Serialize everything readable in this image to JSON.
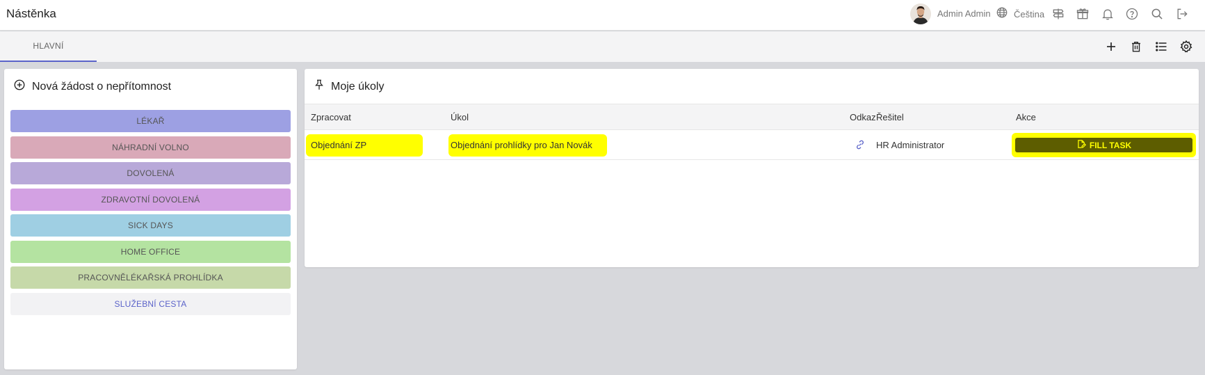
{
  "header": {
    "title": "Nástěnka",
    "user_name": "Admin Admin",
    "language": "Čeština",
    "icons": [
      "globe-icon",
      "signpost-icon",
      "gift-icon",
      "bell-icon",
      "help-icon",
      "search-icon",
      "logout-icon"
    ]
  },
  "tabs": [
    {
      "label": "HLAVNÍ",
      "active": true
    }
  ],
  "tab_tools": [
    "add-icon",
    "trash-icon",
    "list-icon",
    "settings-icon"
  ],
  "absence_card": {
    "title": "Nová žádost o nepřítomnost",
    "buttons": [
      {
        "label": "LÉKAŘ",
        "color": "#9da0e3"
      },
      {
        "label": "NÁHRADNÍ VOLNO",
        "color": "#d9a9b8"
      },
      {
        "label": "DOVOLENÁ",
        "color": "#b8a9d9"
      },
      {
        "label": "ZDRAVOTNÍ DOVOLENÁ",
        "color": "#d3a1e3"
      },
      {
        "label": "SICK DAYS",
        "color": "#9fcfe3"
      },
      {
        "label": "HOME OFFICE",
        "color": "#b4e3a1"
      },
      {
        "label": "PRACOVNĚLÉKAŘSKÁ PROHLÍDKA",
        "color": "#c6d9a9"
      },
      {
        "label": "SLUŽEBNÍ CESTA",
        "color": "#f2f2f4",
        "text_color": "#5b63c9"
      }
    ]
  },
  "tasks_card": {
    "title": "Moje úkoly",
    "columns": {
      "process": "Zpracovat",
      "task": "Úkol",
      "link": "Odkaz",
      "solver": "Řešitel",
      "action": "Akce"
    },
    "rows": [
      {
        "process": "Objednání ZP",
        "task": "Objednání prohlídky pro Jan Novák",
        "solver": "HR Administrator",
        "action_label": "FILL TASK"
      }
    ]
  },
  "colors": {
    "accent": "#5b63c9",
    "highlight": "#ffff00",
    "fill_button": "#5d5d00"
  }
}
